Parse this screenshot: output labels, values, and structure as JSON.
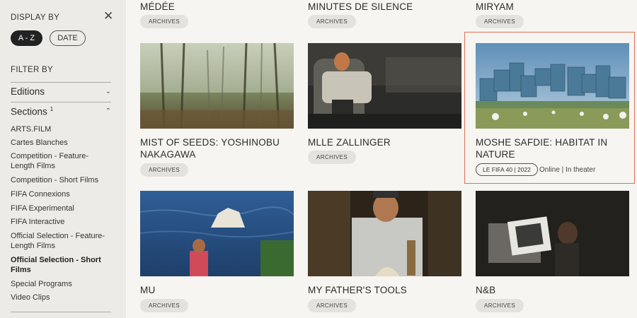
{
  "sidebar": {
    "display_by_label": "DISPLAY BY",
    "sort_options": [
      "A - Z",
      "DATE"
    ],
    "filter_by_label": "FILTER BY",
    "editions_label": "Editions",
    "sections_label": "Sections",
    "sections_count": "1",
    "section_items": [
      "ARTS.FILM",
      "Cartes Blanches",
      "Competition - Feature-Length Films",
      "Competition - Short Films",
      "FIFA Connexions",
      "FIFA Experimental",
      "FIFA Interactive",
      "Official Selection - Feature-Length Films",
      "Official Selection - Short Films",
      "Special Programs",
      "Video Clips"
    ],
    "active_section": "Official Selection - Short Films"
  },
  "films": [
    {
      "title": "MÉDÉE",
      "badge": "ARCHIVES"
    },
    {
      "title": "MINUTES DE SILENCE",
      "badge": "ARCHIVES"
    },
    {
      "title": "MIRYAM",
      "badge": "ARCHIVES"
    },
    {
      "title": "MIST OF SEEDS: YOSHINOBU NAKAGAWA",
      "badge": "ARCHIVES"
    },
    {
      "title": "MLLE ZALLINGER",
      "badge": "ARCHIVES"
    },
    {
      "title": "MOSHE SAFDIE: HABITAT IN NATURE",
      "badge": "LE FIFA 40 | 2022",
      "meta": "Online | In theater"
    },
    {
      "title": "MU",
      "badge": "ARCHIVES"
    },
    {
      "title": "MY FATHER'S TOOLS",
      "badge": "ARCHIVES"
    },
    {
      "title": "N&B",
      "badge": "ARCHIVES"
    }
  ],
  "colors": {
    "highlight": "#e0715a",
    "active_pill": "#222222"
  }
}
